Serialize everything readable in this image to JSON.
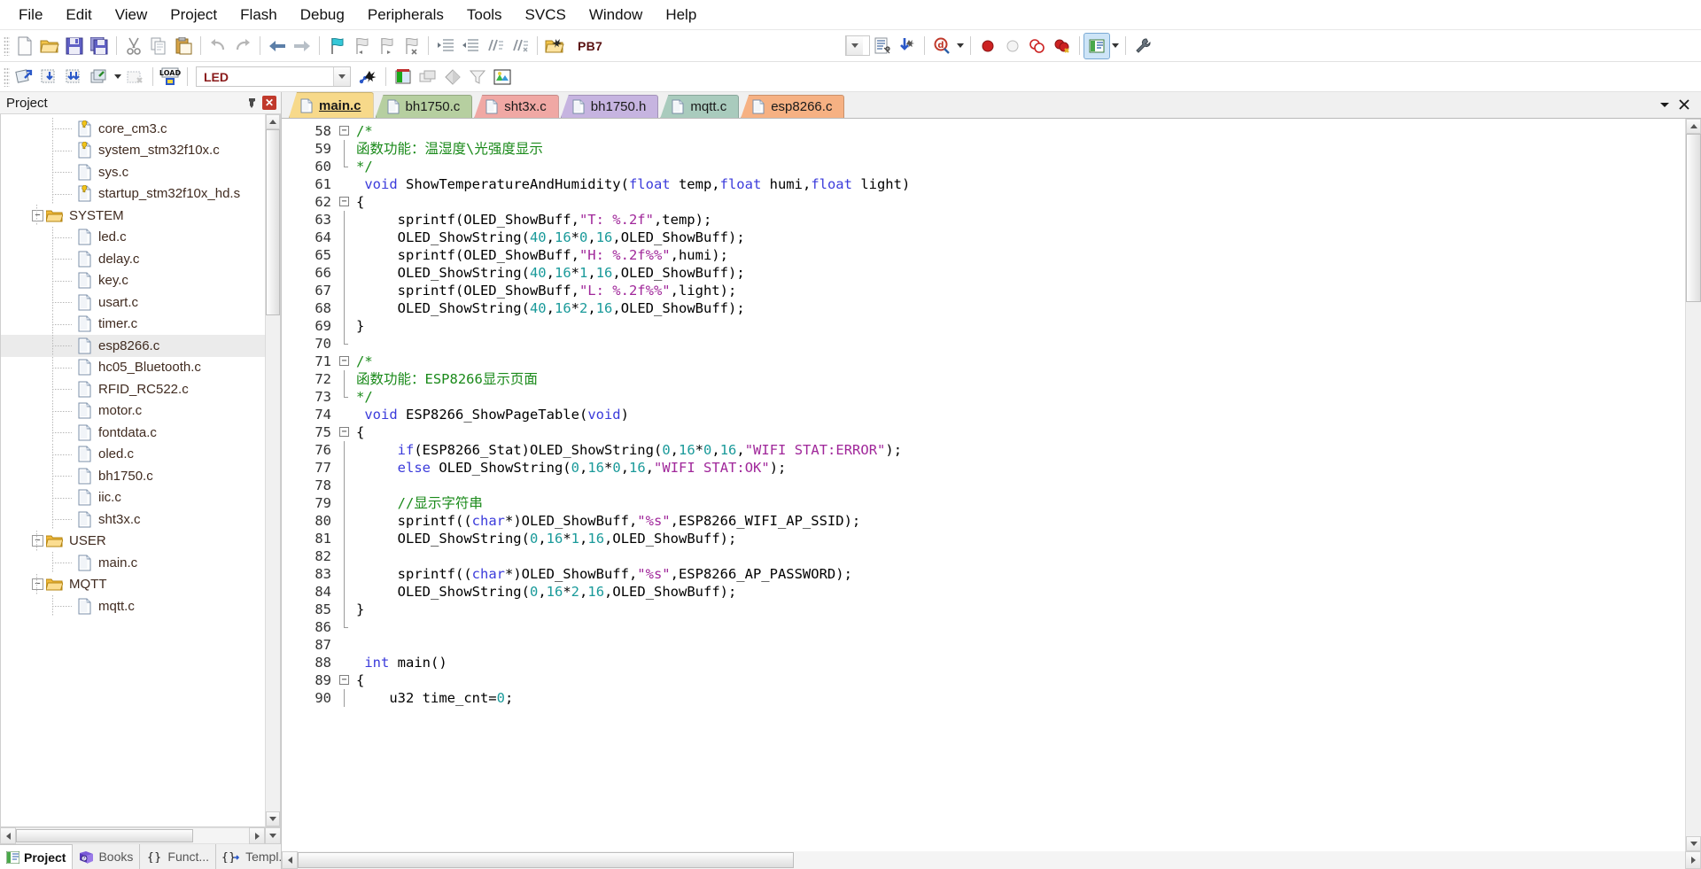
{
  "menu": {
    "items": [
      "File",
      "Edit",
      "View",
      "Project",
      "Flash",
      "Debug",
      "Peripherals",
      "Tools",
      "SVCS",
      "Window",
      "Help"
    ]
  },
  "toolbar1": {
    "icons": [
      "new-file-icon",
      "open-file-icon",
      "save-icon",
      "save-all-icon",
      "cut-icon",
      "copy-icon",
      "paste-icon",
      "undo-icon",
      "redo-icon",
      "navigate-back-icon",
      "navigate-forward-icon",
      "bookmark-toggle-icon",
      "bookmark-prev-icon",
      "bookmark-next-icon",
      "bookmark-clear-icon",
      "indent-right-icon",
      "indent-left-icon",
      "comment-icon",
      "uncomment-icon",
      "find-in-files-icon"
    ],
    "search_value": "PB7",
    "search_placeholder": "",
    "after_icons": [
      "configure-icon",
      "bookmark-insert-icon",
      "find-icon",
      "find-dropdown-icon"
    ],
    "debug_icons": [
      "breakpoint-insert-icon",
      "breakpoint-disable-icon",
      "breakpoint-disable-all-icon",
      "breakpoint-kill-all-icon"
    ],
    "window_icon": "manage-windows-icon",
    "window_dropdown": "window-dropdown-icon",
    "settings_icon": "configure-target-icon"
  },
  "toolbar2": {
    "icons": [
      "translate-icon",
      "build-icon",
      "rebuild-icon",
      "batch-build-icon",
      "stop-build-icon",
      "download-icon"
    ],
    "target_value": "LED",
    "target_placeholder": "",
    "after_icons": [
      "target-options-icon",
      "manage-project-items-icon",
      "multiproject-icon",
      "pack-installer-icon",
      "svcs-icon",
      "manage-runtime-icon"
    ]
  },
  "project_panel": {
    "title": "Project",
    "pin_icon": "pin-icon",
    "close_icon": "close-icon",
    "tree": [
      {
        "label": "core_cm3.c",
        "indent": 3,
        "type": "file-key",
        "selected": false
      },
      {
        "label": "system_stm32f10x.c",
        "indent": 3,
        "type": "file-key",
        "selected": false
      },
      {
        "label": "sys.c",
        "indent": 3,
        "type": "file",
        "selected": false
      },
      {
        "label": "startup_stm32f10x_hd.s",
        "indent": 3,
        "type": "file-key",
        "selected": false
      },
      {
        "label": "SYSTEM",
        "indent": 2,
        "type": "folder-open",
        "selected": false
      },
      {
        "label": "led.c",
        "indent": 3,
        "type": "file",
        "selected": false
      },
      {
        "label": "delay.c",
        "indent": 3,
        "type": "file",
        "selected": false
      },
      {
        "label": "key.c",
        "indent": 3,
        "type": "file",
        "selected": false
      },
      {
        "label": "usart.c",
        "indent": 3,
        "type": "file",
        "selected": false
      },
      {
        "label": "timer.c",
        "indent": 3,
        "type": "file",
        "selected": false
      },
      {
        "label": "esp8266.c",
        "indent": 3,
        "type": "file",
        "selected": true
      },
      {
        "label": "hc05_Bluetooth.c",
        "indent": 3,
        "type": "file",
        "selected": false
      },
      {
        "label": "RFID_RC522.c",
        "indent": 3,
        "type": "file",
        "selected": false
      },
      {
        "label": "motor.c",
        "indent": 3,
        "type": "file",
        "selected": false
      },
      {
        "label": "fontdata.c",
        "indent": 3,
        "type": "file",
        "selected": false
      },
      {
        "label": "oled.c",
        "indent": 3,
        "type": "file",
        "selected": false
      },
      {
        "label": "bh1750.c",
        "indent": 3,
        "type": "file",
        "selected": false
      },
      {
        "label": "iic.c",
        "indent": 3,
        "type": "file",
        "selected": false
      },
      {
        "label": "sht3x.c",
        "indent": 3,
        "type": "file",
        "selected": false
      },
      {
        "label": "USER",
        "indent": 2,
        "type": "folder-open",
        "selected": false
      },
      {
        "label": "main.c",
        "indent": 3,
        "type": "file",
        "selected": false
      },
      {
        "label": "MQTT",
        "indent": 2,
        "type": "folder-open",
        "selected": false
      },
      {
        "label": "mqtt.c",
        "indent": 3,
        "type": "file",
        "selected": false
      }
    ],
    "bottom_tabs": [
      {
        "label": "Project",
        "icon": "project-icon",
        "active": true
      },
      {
        "label": "Books",
        "icon": "books-icon",
        "active": false
      },
      {
        "label": "Funct...",
        "icon": "functions-icon",
        "active": false
      },
      {
        "label": "Templ...",
        "icon": "templates-icon",
        "active": false
      }
    ]
  },
  "editor": {
    "tabs": [
      {
        "label": "main.c",
        "color": "#f7d98a",
        "active": true
      },
      {
        "label": "bh1750.c",
        "color": "#b6cfa0",
        "active": false
      },
      {
        "label": "sht3x.c",
        "color": "#f0a8a4",
        "active": false
      },
      {
        "label": "bh1750.h",
        "color": "#c6b4e0",
        "active": false
      },
      {
        "label": "mqtt.c",
        "color": "#a9cbbd",
        "active": false
      },
      {
        "label": "esp8266.c",
        "color": "#f6b183",
        "active": false
      }
    ],
    "tabbar_controls": [
      "tab-list-dropdown-icon",
      "close-document-icon"
    ],
    "first_line": 58,
    "lines": [
      {
        "n": 58,
        "fold": "start",
        "tokens": [
          {
            "t": "/*",
            "c": "cmt"
          }
        ]
      },
      {
        "n": 59,
        "fold": "bar",
        "tokens": [
          {
            "t": "函数功能：温湿度\\光强度显示",
            "c": "cmt"
          }
        ]
      },
      {
        "n": 60,
        "fold": "end",
        "tokens": [
          {
            "t": "*/",
            "c": "cmt"
          }
        ]
      },
      {
        "n": 61,
        "fold": "none",
        "tokens": [
          {
            "t": " ",
            "c": "pln"
          },
          {
            "t": "void",
            "c": "kw"
          },
          {
            "t": " ShowTemperatureAndHumidity(",
            "c": "pln"
          },
          {
            "t": "float",
            "c": "kw"
          },
          {
            "t": " temp,",
            "c": "pln"
          },
          {
            "t": "float",
            "c": "kw"
          },
          {
            "t": " humi,",
            "c": "pln"
          },
          {
            "t": "float",
            "c": "kw"
          },
          {
            "t": " light)",
            "c": "pln"
          }
        ]
      },
      {
        "n": 62,
        "fold": "start",
        "tokens": [
          {
            "t": "{",
            "c": "pln"
          }
        ]
      },
      {
        "n": 63,
        "fold": "bar",
        "tokens": [
          {
            "t": "     sprintf(OLED_ShowBuff,",
            "c": "pln"
          },
          {
            "t": "\"T: %.2f\"",
            "c": "str"
          },
          {
            "t": ",temp);",
            "c": "pln"
          }
        ]
      },
      {
        "n": 64,
        "fold": "bar",
        "tokens": [
          {
            "t": "     OLED_ShowString(",
            "c": "pln"
          },
          {
            "t": "40",
            "c": "num"
          },
          {
            "t": ",",
            "c": "pln"
          },
          {
            "t": "16",
            "c": "num"
          },
          {
            "t": "*",
            "c": "pln"
          },
          {
            "t": "0",
            "c": "num"
          },
          {
            "t": ",",
            "c": "pln"
          },
          {
            "t": "16",
            "c": "num"
          },
          {
            "t": ",OLED_ShowBuff);",
            "c": "pln"
          }
        ]
      },
      {
        "n": 65,
        "fold": "bar",
        "tokens": [
          {
            "t": "     sprintf(OLED_ShowBuff,",
            "c": "pln"
          },
          {
            "t": "\"H: %.2f%%\"",
            "c": "str"
          },
          {
            "t": ",humi);",
            "c": "pln"
          }
        ]
      },
      {
        "n": 66,
        "fold": "bar",
        "tokens": [
          {
            "t": "     OLED_ShowString(",
            "c": "pln"
          },
          {
            "t": "40",
            "c": "num"
          },
          {
            "t": ",",
            "c": "pln"
          },
          {
            "t": "16",
            "c": "num"
          },
          {
            "t": "*",
            "c": "pln"
          },
          {
            "t": "1",
            "c": "num"
          },
          {
            "t": ",",
            "c": "pln"
          },
          {
            "t": "16",
            "c": "num"
          },
          {
            "t": ",OLED_ShowBuff);",
            "c": "pln"
          }
        ]
      },
      {
        "n": 67,
        "fold": "bar",
        "tokens": [
          {
            "t": "     sprintf(OLED_ShowBuff,",
            "c": "pln"
          },
          {
            "t": "\"L: %.2f%%\"",
            "c": "str"
          },
          {
            "t": ",light);",
            "c": "pln"
          }
        ]
      },
      {
        "n": 68,
        "fold": "bar",
        "tokens": [
          {
            "t": "     OLED_ShowString(",
            "c": "pln"
          },
          {
            "t": "40",
            "c": "num"
          },
          {
            "t": ",",
            "c": "pln"
          },
          {
            "t": "16",
            "c": "num"
          },
          {
            "t": "*",
            "c": "pln"
          },
          {
            "t": "2",
            "c": "num"
          },
          {
            "t": ",",
            "c": "pln"
          },
          {
            "t": "16",
            "c": "num"
          },
          {
            "t": ",OLED_ShowBuff);",
            "c": "pln"
          }
        ]
      },
      {
        "n": 69,
        "fold": "bar",
        "tokens": [
          {
            "t": "}",
            "c": "pln"
          }
        ]
      },
      {
        "n": 70,
        "fold": "close",
        "tokens": [
          {
            "t": "",
            "c": "pln"
          }
        ]
      },
      {
        "n": 71,
        "fold": "start",
        "tokens": [
          {
            "t": "/*",
            "c": "cmt"
          }
        ]
      },
      {
        "n": 72,
        "fold": "bar",
        "tokens": [
          {
            "t": "函数功能：ESP8266显示页面",
            "c": "cmt"
          }
        ]
      },
      {
        "n": 73,
        "fold": "end",
        "tokens": [
          {
            "t": "*/",
            "c": "cmt"
          }
        ]
      },
      {
        "n": 74,
        "fold": "none",
        "tokens": [
          {
            "t": " ",
            "c": "pln"
          },
          {
            "t": "void",
            "c": "kw"
          },
          {
            "t": " ESP8266_ShowPageTable(",
            "c": "pln"
          },
          {
            "t": "void",
            "c": "kw"
          },
          {
            "t": ")",
            "c": "pln"
          }
        ]
      },
      {
        "n": 75,
        "fold": "start",
        "tokens": [
          {
            "t": "{",
            "c": "pln"
          }
        ]
      },
      {
        "n": 76,
        "fold": "bar",
        "tokens": [
          {
            "t": "     ",
            "c": "pln"
          },
          {
            "t": "if",
            "c": "kw"
          },
          {
            "t": "(ESP8266_Stat)OLED_ShowString(",
            "c": "pln"
          },
          {
            "t": "0",
            "c": "num"
          },
          {
            "t": ",",
            "c": "pln"
          },
          {
            "t": "16",
            "c": "num"
          },
          {
            "t": "*",
            "c": "pln"
          },
          {
            "t": "0",
            "c": "num"
          },
          {
            "t": ",",
            "c": "pln"
          },
          {
            "t": "16",
            "c": "num"
          },
          {
            "t": ",",
            "c": "pln"
          },
          {
            "t": "\"WIFI STAT:ERROR\"",
            "c": "str"
          },
          {
            "t": ");",
            "c": "pln"
          }
        ]
      },
      {
        "n": 77,
        "fold": "bar",
        "tokens": [
          {
            "t": "     ",
            "c": "pln"
          },
          {
            "t": "else",
            "c": "kw"
          },
          {
            "t": " OLED_ShowString(",
            "c": "pln"
          },
          {
            "t": "0",
            "c": "num"
          },
          {
            "t": ",",
            "c": "pln"
          },
          {
            "t": "16",
            "c": "num"
          },
          {
            "t": "*",
            "c": "pln"
          },
          {
            "t": "0",
            "c": "num"
          },
          {
            "t": ",",
            "c": "pln"
          },
          {
            "t": "16",
            "c": "num"
          },
          {
            "t": ",",
            "c": "pln"
          },
          {
            "t": "\"WIFI STAT:OK\"",
            "c": "str"
          },
          {
            "t": ");",
            "c": "pln"
          }
        ]
      },
      {
        "n": 78,
        "fold": "bar",
        "tokens": [
          {
            "t": "",
            "c": "pln"
          }
        ]
      },
      {
        "n": 79,
        "fold": "bar",
        "tokens": [
          {
            "t": "     ",
            "c": "pln"
          },
          {
            "t": "//显示字符串",
            "c": "cmt"
          }
        ]
      },
      {
        "n": 80,
        "fold": "bar",
        "tokens": [
          {
            "t": "     sprintf((",
            "c": "pln"
          },
          {
            "t": "char",
            "c": "kw"
          },
          {
            "t": "*)OLED_ShowBuff,",
            "c": "pln"
          },
          {
            "t": "\"%s\"",
            "c": "str"
          },
          {
            "t": ",ESP8266_WIFI_AP_SSID);",
            "c": "pln"
          }
        ]
      },
      {
        "n": 81,
        "fold": "bar",
        "tokens": [
          {
            "t": "     OLED_ShowString(",
            "c": "pln"
          },
          {
            "t": "0",
            "c": "num"
          },
          {
            "t": ",",
            "c": "pln"
          },
          {
            "t": "16",
            "c": "num"
          },
          {
            "t": "*",
            "c": "pln"
          },
          {
            "t": "1",
            "c": "num"
          },
          {
            "t": ",",
            "c": "pln"
          },
          {
            "t": "16",
            "c": "num"
          },
          {
            "t": ",OLED_ShowBuff);",
            "c": "pln"
          }
        ]
      },
      {
        "n": 82,
        "fold": "bar",
        "tokens": [
          {
            "t": "",
            "c": "pln"
          }
        ]
      },
      {
        "n": 83,
        "fold": "bar",
        "tokens": [
          {
            "t": "     sprintf((",
            "c": "pln"
          },
          {
            "t": "char",
            "c": "kw"
          },
          {
            "t": "*)OLED_ShowBuff,",
            "c": "pln"
          },
          {
            "t": "\"%s\"",
            "c": "str"
          },
          {
            "t": ",ESP8266_AP_PASSWORD);",
            "c": "pln"
          }
        ]
      },
      {
        "n": 84,
        "fold": "bar",
        "tokens": [
          {
            "t": "     OLED_ShowString(",
            "c": "pln"
          },
          {
            "t": "0",
            "c": "num"
          },
          {
            "t": ",",
            "c": "pln"
          },
          {
            "t": "16",
            "c": "num"
          },
          {
            "t": "*",
            "c": "pln"
          },
          {
            "t": "2",
            "c": "num"
          },
          {
            "t": ",",
            "c": "pln"
          },
          {
            "t": "16",
            "c": "num"
          },
          {
            "t": ",OLED_ShowBuff);",
            "c": "pln"
          }
        ]
      },
      {
        "n": 85,
        "fold": "bar",
        "tokens": [
          {
            "t": "}",
            "c": "pln"
          }
        ]
      },
      {
        "n": 86,
        "fold": "close",
        "tokens": [
          {
            "t": "",
            "c": "pln"
          }
        ]
      },
      {
        "n": 87,
        "fold": "none",
        "tokens": [
          {
            "t": "",
            "c": "pln"
          }
        ]
      },
      {
        "n": 88,
        "fold": "none",
        "tokens": [
          {
            "t": " ",
            "c": "pln"
          },
          {
            "t": "int",
            "c": "kw"
          },
          {
            "t": " main()",
            "c": "pln"
          }
        ]
      },
      {
        "n": 89,
        "fold": "start",
        "tokens": [
          {
            "t": "{",
            "c": "pln"
          }
        ]
      },
      {
        "n": 90,
        "fold": "bar",
        "tokens": [
          {
            "t": "    u32 time_cnt=",
            "c": "pln"
          },
          {
            "t": "0",
            "c": "num"
          },
          {
            "t": ";",
            "c": "pln"
          }
        ]
      }
    ]
  },
  "colors": {
    "comment": "#1a8a1a",
    "keyword": "#3b3bdb",
    "string": "#a0279a",
    "number": "#1a9a9a",
    "selection": "#ebebeb",
    "accent": "#c0392b"
  }
}
